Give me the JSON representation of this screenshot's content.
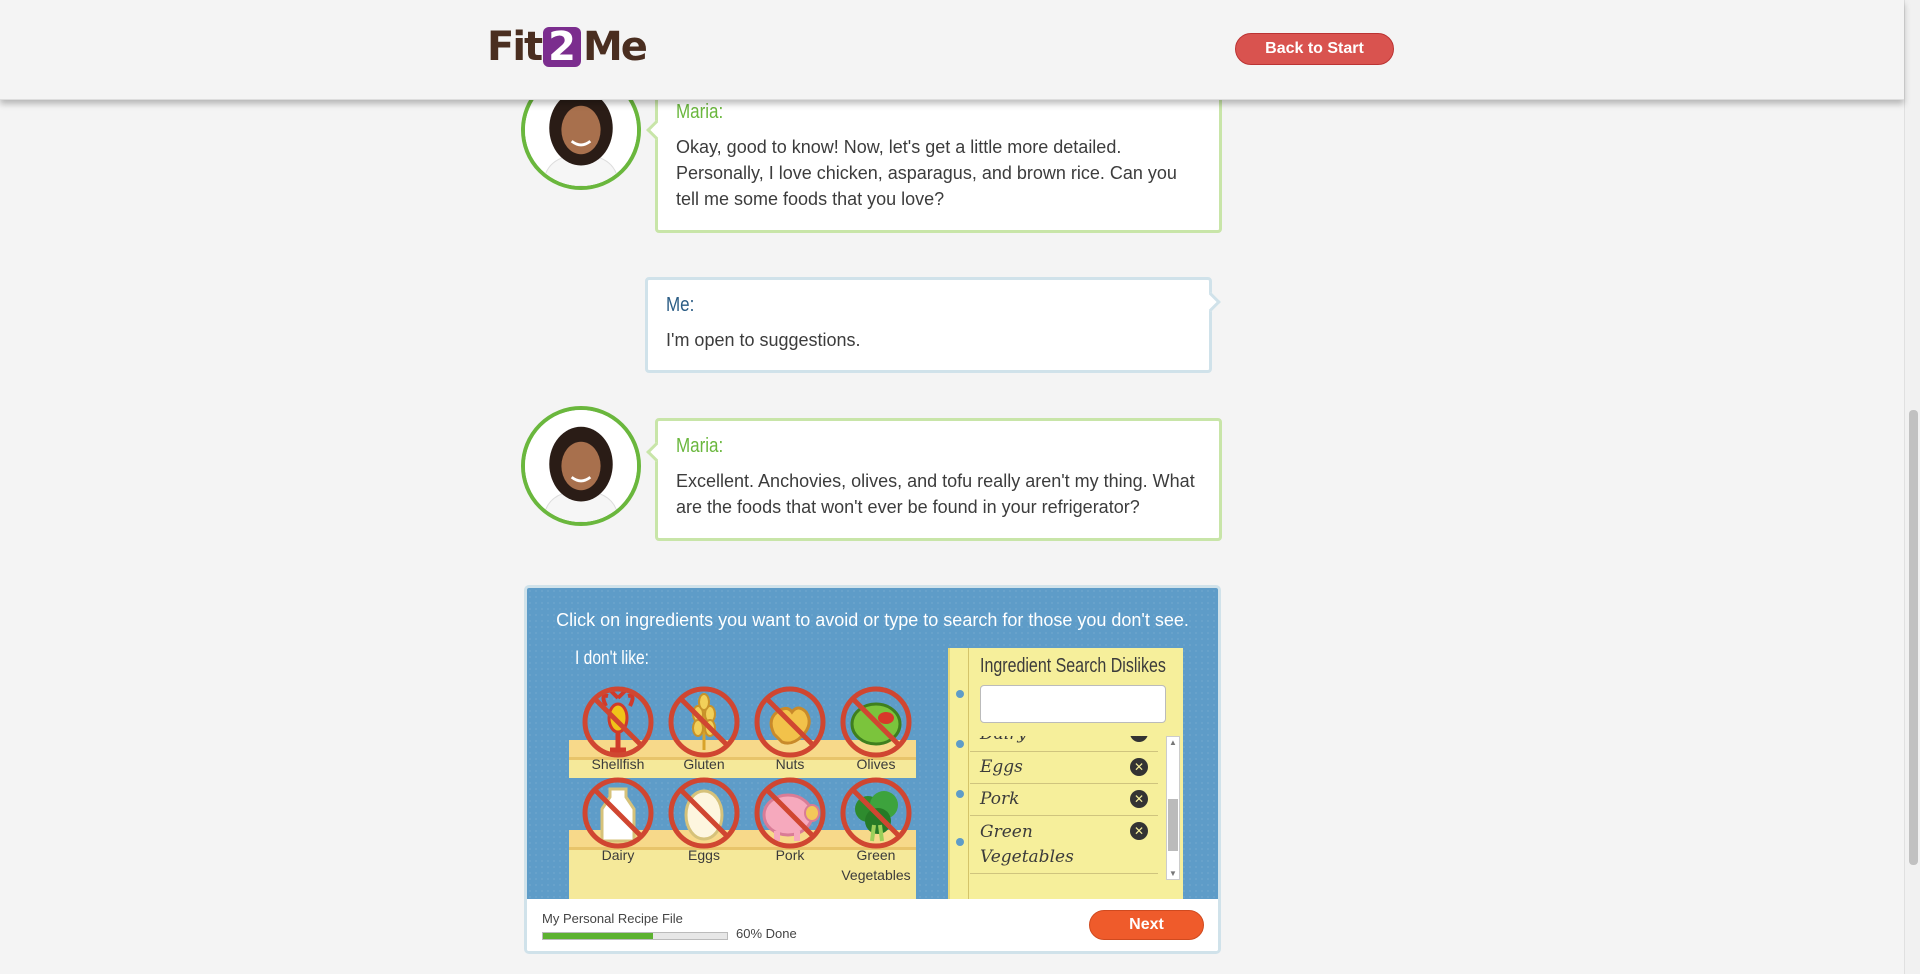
{
  "header": {
    "logo": {
      "pre": "Fit",
      "two": "2",
      "post": "Me"
    },
    "back_label": "Back to Start"
  },
  "chat": [
    {
      "speaker": "Maria:",
      "text": "Okay, good to know! Now, let's get a little more detailed. Personally, I love chicken, asparagus, and brown rice. Can you tell me some foods that you love?"
    },
    {
      "speaker": "Me:",
      "text": "I'm open to suggestions."
    },
    {
      "speaker": "Maria:",
      "text": "Excellent. Anchovies, olives, and tofu really aren't my thing. What are the foods that won't ever be found in your refrigerator?"
    }
  ],
  "panel": {
    "instruction": "Click on ingredients you want to avoid or type to search for those you don't see.",
    "dislike_label": "I don't like:",
    "ingredients": [
      "Shellfish",
      "Gluten",
      "Nuts",
      "Olives",
      "Dairy",
      "Eggs",
      "Pork",
      "Green Vegetables"
    ],
    "search": {
      "title": "Ingredient Search Dislikes",
      "value": "",
      "selected": [
        "Dairy",
        "Eggs",
        "Pork",
        "Green Vegetables"
      ]
    },
    "footer": {
      "recipe_label": "My Personal Recipe File",
      "progress": 0.6,
      "progress_text": "60% Done",
      "next_label": "Next"
    }
  },
  "colors": {
    "brand_purple": "#7b2d8e",
    "maria_green": "#6ab73d",
    "me_blue": "#2b5d85",
    "panel_blue": "#5e9cc8",
    "button_red": "#d9534f",
    "next_orange": "#ef5b2b",
    "ban_red": "#d04631"
  },
  "icons": {
    "shellfish": "lobster-icon",
    "gluten": "wheat-icon",
    "nuts": "peanut-icon",
    "olives": "olive-icon",
    "dairy": "milk-bottle-icon",
    "eggs": "egg-icon",
    "pork": "pig-icon",
    "green_vegetables": "broccoli-icon",
    "ban": "no-symbol-icon",
    "remove": "close-circle-icon"
  }
}
